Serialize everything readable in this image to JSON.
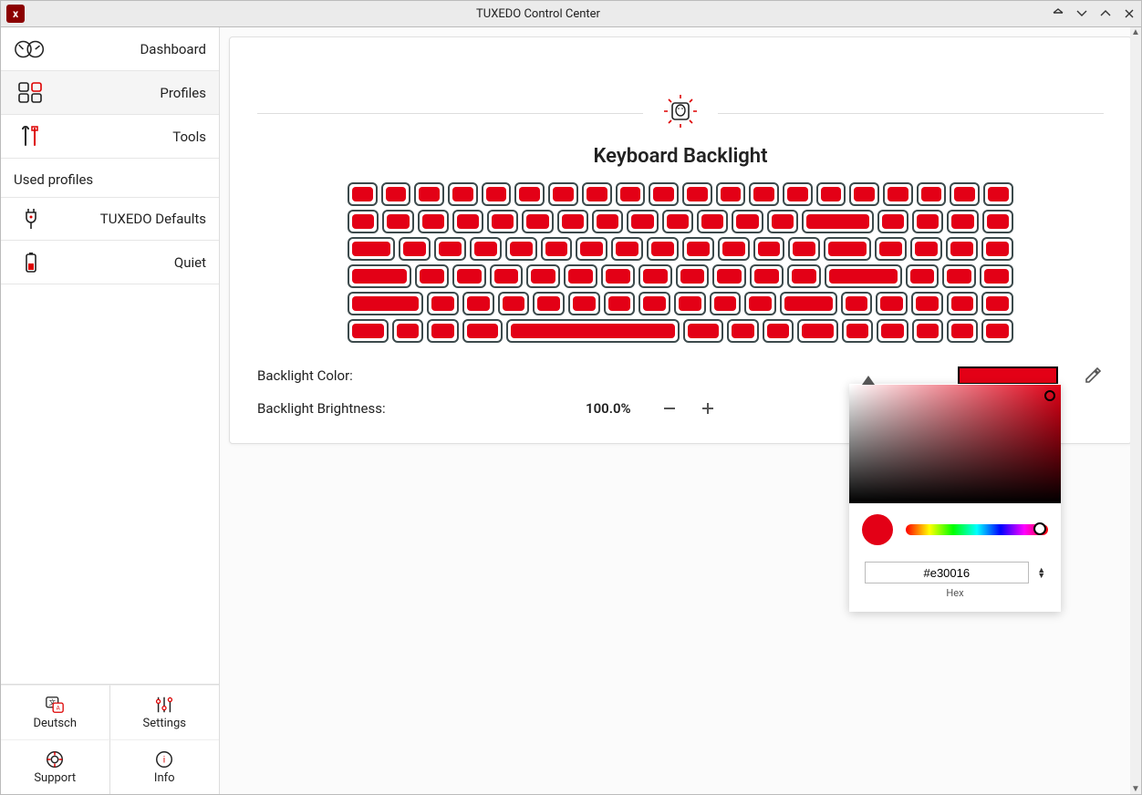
{
  "window": {
    "title": "TUXEDO Control Center"
  },
  "sidebar": {
    "nav": [
      {
        "label": "Dashboard"
      },
      {
        "label": "Profiles"
      },
      {
        "label": "Tools"
      }
    ],
    "used_profiles_header": "Used profiles",
    "profiles": [
      {
        "label": "TUXEDO Defaults"
      },
      {
        "label": "Quiet"
      }
    ],
    "bottom": {
      "language": "Deutsch",
      "settings": "Settings",
      "support": "Support",
      "info": "Info"
    }
  },
  "page": {
    "title": "Keyboard Backlight",
    "color_label": "Backlight Color:",
    "brightness_label": "Backlight Brightness:",
    "brightness_value": "100.0%"
  },
  "picker": {
    "hex_value": "#e30016",
    "hex_caption": "Hex"
  },
  "colors": {
    "accent": "#e30016"
  }
}
